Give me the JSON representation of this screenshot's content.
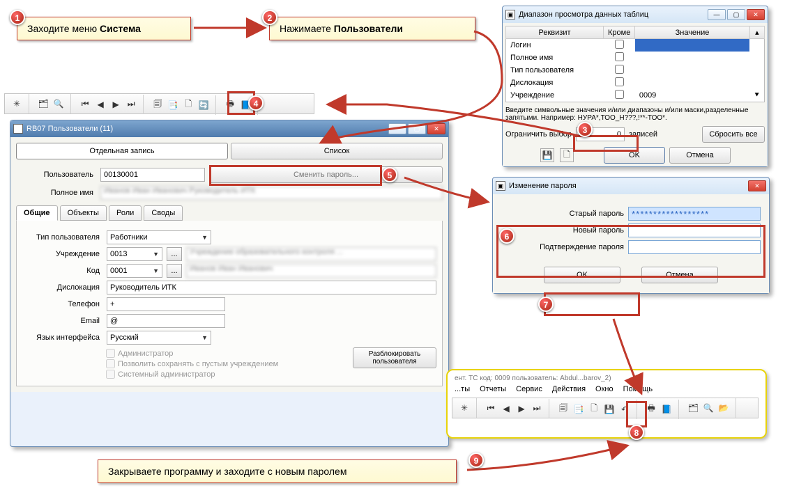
{
  "callouts": {
    "c1": "Заходите меню ",
    "c1b": "Система",
    "c2": "Нажимаете ",
    "c2b": "Пользователи",
    "c9a": "Закрываете программу и заходите с новым паролем"
  },
  "markers": [
    "1",
    "2",
    "3",
    "4",
    "5",
    "6",
    "7",
    "8",
    "9"
  ],
  "toolbar": {
    "icons": [
      "⚙",
      "📋",
      "🔍",
      "⏮",
      "◀",
      "▶",
      "⏭",
      "📂",
      "📑",
      "🗋",
      "🗐",
      "🖶",
      "📘"
    ]
  },
  "users_window": {
    "title": "RB07 Пользователи (11)",
    "btn_record": "Отдельная запись",
    "btn_list": "Список",
    "lbl_user": "Пользователь",
    "val_user": "00130001",
    "btn_change_pwd": "Сменить пароль...",
    "lbl_fullname": "Полное имя",
    "val_fullname": "Иванов Иван Иванович Руководитель ИТК",
    "tabs": [
      "Общие",
      "Объекты",
      "Роли",
      "Своды"
    ],
    "lbl_usertype": "Тип пользователя",
    "val_usertype": "Работники",
    "lbl_inst": "Учреждение",
    "val_inst": "0013",
    "val_inst_desc": "Учреждение образовательного контроля ...",
    "lbl_code": "Код",
    "val_code": "0001",
    "val_code_desc": "Иванов Иван Иванович",
    "lbl_location": "Дислокация",
    "val_location": "Руководитель ИТК",
    "lbl_phone": "Телефон",
    "val_phone": "+",
    "lbl_email": "Email",
    "val_email": "@",
    "lbl_lang": "Язык интерфейса",
    "val_lang": "Русский",
    "chk_admin": "Администратор",
    "chk_empty": "Позволить сохранять с пустым учреждением",
    "chk_sysadmin": "Системный администратор",
    "btn_unlock": "Разблокировать\nпользователя"
  },
  "range_dialog": {
    "title": "Диапазон просмотра данных таблиц",
    "col_req": "Реквизит",
    "col_except": "Кроме",
    "col_val": "Значение",
    "rows": [
      {
        "r": "Логин",
        "v": ""
      },
      {
        "r": "Полное имя",
        "v": ""
      },
      {
        "r": "Тип пользователя",
        "v": ""
      },
      {
        "r": "Дислокация",
        "v": ""
      },
      {
        "r": "Учреждение",
        "v": "0009"
      }
    ],
    "hint": "Введите символьные значения и/или диапазоны и/или маски,разделенные запятыми. Например: НУРА*,ТОО_Н???,!**-ТОО*.",
    "lbl_limit": "Ограничить выбор",
    "val_limit": "0",
    "lbl_records": "записей",
    "btn_reset": "Сбросить все",
    "btn_ok": "OK",
    "btn_cancel": "Отмена"
  },
  "pwd_dialog": {
    "title": "Изменение пароля",
    "lbl_old": "Старый пароль",
    "val_old": "******************",
    "lbl_new": "Новый пароль",
    "lbl_confirm": "Подтверждение пароля",
    "btn_ok": "OK",
    "btn_cancel": "Отмена"
  },
  "yellow_toolbar": {
    "title_frag": "ент. ТС код: 0009 пользователь: Abdul...barov_2)",
    "menus": [
      "...ты",
      "Отчеты",
      "Сервис",
      "Действия",
      "Окно",
      "Помощь"
    ]
  }
}
